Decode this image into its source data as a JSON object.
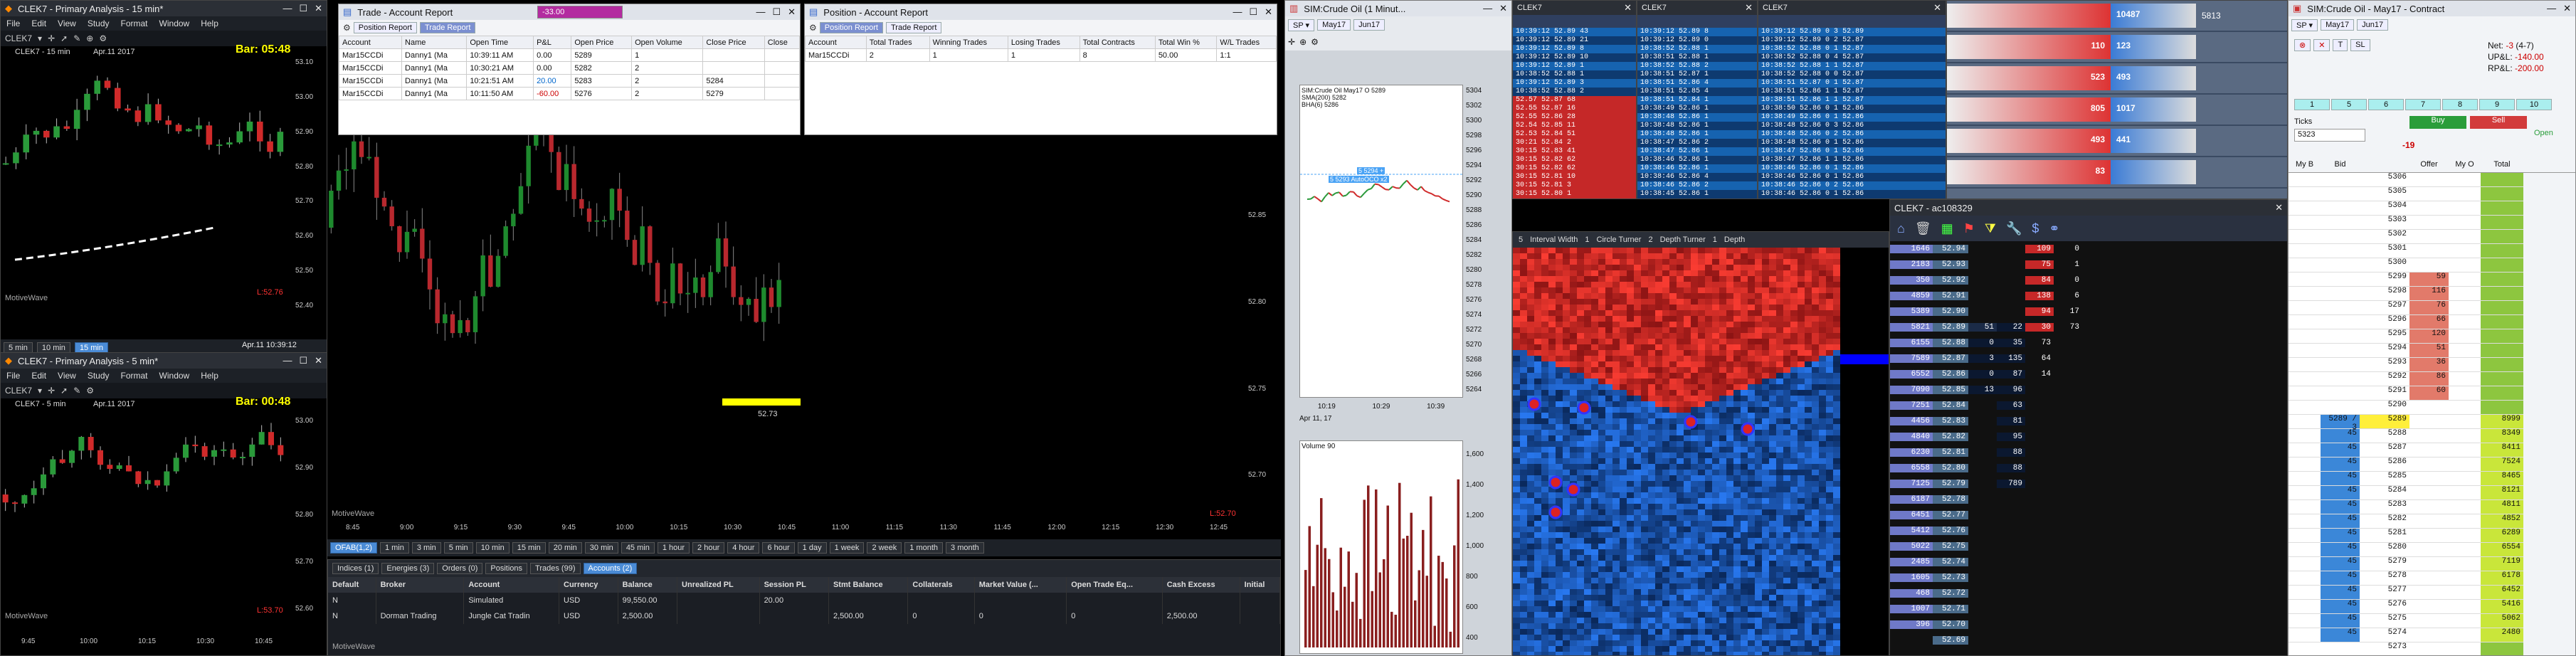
{
  "chart15": {
    "title": "CLEK7 - Primary Analysis - 15 min*",
    "menu": [
      "File",
      "Edit",
      "View",
      "Study",
      "Format",
      "Window",
      "Help"
    ],
    "symbol": "CLEK7",
    "subtitle": "CLEK7 - 15 min",
    "date": "Apr.11 2017",
    "bar_timer": "Bar: 05:48",
    "brand": "MotiveWave",
    "intervals": [
      "5 min",
      "10 min",
      "15 min"
    ],
    "stamp": "Apr.11 10:39:12",
    "prices": [
      "53.10",
      "53.00",
      "52.90",
      "52.80",
      "52.70",
      "52.60",
      "52.50",
      "52.40"
    ],
    "price_tags": [
      "52.97",
      "52.84",
      "52.84",
      "52.85"
    ],
    "times": [
      "9:30",
      "9:45",
      "10:00",
      "10:15",
      "10:30"
    ],
    "last": "L:52.76"
  },
  "chart5": {
    "title": "CLEK7 - Primary Analysis - 5 min*",
    "menu": [
      "File",
      "Edit",
      "View",
      "Study",
      "Format",
      "Window",
      "Help"
    ],
    "symbol": "CLEK7",
    "subtitle": "CLEK7 - 5 min",
    "date": "Apr.11 2017",
    "bar_timer": "Bar: 00:48",
    "brand": "MotiveWave",
    "prices": [
      "53.00",
      "52.90",
      "52.80",
      "52.70",
      "52.60"
    ],
    "price_tags": [
      "52.90",
      "52.84",
      "52.84"
    ],
    "times": [
      "9:45",
      "10:00",
      "10:15",
      "10:30",
      "10:45"
    ],
    "last": "L:53.70"
  },
  "trade_report": {
    "title": "Trade - Account Report",
    "tabs": [
      "Position Report",
      "Trade Report"
    ],
    "columns": [
      "Account",
      "Name",
      "Open Time",
      "P&L",
      "Open Price",
      "Open Volume",
      "Close Price",
      "Close"
    ],
    "rows": [
      [
        "Mar15CCDi",
        "Danny1 (Ma",
        "10:39:11 AM",
        "0.00",
        "5289",
        "1",
        "",
        ""
      ],
      [
        "Mar15CCDi",
        "Danny1 (Ma",
        "10:30:21 AM",
        "0.00",
        "5282",
        "2",
        "",
        ""
      ],
      [
        "Mar15CCDi",
        "Danny1 (Ma",
        "10:21:51 AM",
        "20.00",
        "5283",
        "2",
        "5284",
        ""
      ],
      [
        "Mar15CCDi",
        "Danny1 (Ma",
        "10:11:50 AM",
        "-60.00",
        "5276",
        "2",
        "5279",
        ""
      ]
    ],
    "pl_badge": "-33.00"
  },
  "position_report": {
    "title": "Position - Account Report",
    "tabs": [
      "Position Report",
      "Trade Report"
    ],
    "columns": [
      "Account",
      "Total Trades",
      "Winning Trades",
      "Losing Trades",
      "Total Contracts",
      "Total Win %",
      "W/L Trades"
    ],
    "rows": [
      [
        "Mar15CCDi",
        "2",
        "1",
        "1",
        "8",
        "50.00",
        "1:1"
      ]
    ]
  },
  "main_chart": {
    "brand": "MotiveWave",
    "prices": [
      "52.95",
      "52.90",
      "52.85",
      "52.80",
      "52.75",
      "52.70"
    ],
    "price_tags": [
      "52.90",
      "52.85",
      "52.84",
      "52.73"
    ],
    "times": [
      "8:45",
      "9:00",
      "9:15",
      "9:30",
      "9:45",
      "10:00",
      "10:15",
      "10:30",
      "10:45",
      "11:00",
      "11:15",
      "11:30",
      "11:45",
      "12:00",
      "12:15",
      "12:30",
      "12:45"
    ],
    "poc_label": "52.73",
    "last": "L:52.70",
    "intervals": [
      "OFAB(1,2)",
      "1 min",
      "3 min",
      "5 min",
      "10 min",
      "15 min",
      "20 min",
      "30 min",
      "45 min",
      "1 hour",
      "2 hour",
      "4 hour",
      "6 hour",
      "1 day",
      "1 week",
      "2 week",
      "1 month",
      "3 month"
    ]
  },
  "accounts": {
    "tabs": [
      "Indices (1)",
      "Energies (3)",
      "Orders (0)",
      "Positions",
      "Trades (99)",
      "Accounts (2)"
    ],
    "columns": [
      "Default",
      "Broker",
      "Account",
      "Currency",
      "Balance",
      "Unrealized PL",
      "Session PL",
      "Stmt Balance",
      "Collaterals",
      "Market Value (...",
      "Open Trade Eq...",
      "Cash Excess",
      "Initial"
    ],
    "rows": [
      [
        "N",
        "",
        "Simulated",
        "USD",
        "99,550.00",
        "",
        "20.00",
        "",
        "",
        "",
        "",
        "",
        ""
      ],
      [
        "N",
        "Dorman Trading",
        "Jungle Cat Tradin",
        "USD",
        "2,500.00",
        "",
        "",
        "2,500.00",
        "0",
        "0",
        "0",
        "2,500.00",
        ""
      ]
    ],
    "brand": "MotiveWave"
  },
  "mini_chart": {
    "title": "SIM:Crude Oil (1 Minut...",
    "dropdowns": [
      "May17",
      "Jun17"
    ],
    "legend": [
      "SIM:Crude Oil May17 O 5289",
      "SMA(200) 5282",
      "BHA(6) 5286"
    ],
    "prices": [
      "5304",
      "5302",
      "5300",
      "5298",
      "5296",
      "5294",
      "5292",
      "5290",
      "5288",
      "5286",
      "5284",
      "5282",
      "5280",
      "5278",
      "5276",
      "5274",
      "5272",
      "5270",
      "5268",
      "5266",
      "5264"
    ],
    "times": [
      "10:19",
      "10:29",
      "10:39"
    ],
    "date": "Apr 11, 17",
    "order_labels": [
      "5 5294 +",
      "5 5293 AutoOCO x2"
    ],
    "last": "5289",
    "volume_title": "Volume 90",
    "volume_axis": [
      "1,600",
      "1,400",
      "1,200",
      "1,000",
      "800",
      "600",
      "400"
    ]
  },
  "tape1": {
    "title": "CLEK7",
    "rows": [
      [
        "10:39:12",
        "52.89",
        "43"
      ],
      [
        "10:39:12",
        "52.89",
        "21"
      ],
      [
        "10:39:12",
        "52.89",
        "8"
      ],
      [
        "10:39:12",
        "52.89",
        "10"
      ],
      [
        "10:39:12",
        "52.89",
        "1"
      ],
      [
        "10:38:52",
        "52.88",
        "1"
      ],
      [
        "10:39:12",
        "52.89",
        "3"
      ],
      [
        "10:38:52",
        "52.88",
        "2"
      ],
      [
        "52.57",
        "52.87",
        "68"
      ],
      [
        "52.55",
        "52.87",
        "16"
      ],
      [
        "52.55",
        "52.86",
        "28"
      ],
      [
        "52.54",
        "52.85",
        "11"
      ],
      [
        "52.53",
        "52.84",
        "51"
      ],
      [
        "30:21",
        "52.84",
        "2"
      ],
      [
        "30:15",
        "52.83",
        "41"
      ],
      [
        "30:15",
        "52.82",
        "62"
      ],
      [
        "30:15",
        "52.82",
        "62"
      ],
      [
        "30:15",
        "52.81",
        "10"
      ],
      [
        "30:15",
        "52.81",
        "3"
      ],
      [
        "30:15",
        "52.80",
        "1"
      ]
    ]
  },
  "tape2": {
    "title": "CLEK7",
    "rows": [
      [
        "10:39:12",
        "52.89",
        "8"
      ],
      [
        "10:39:12",
        "52.89",
        "0"
      ],
      [
        "10:38:52",
        "52.88",
        "1"
      ],
      [
        "10:38:51",
        "52.88",
        "1"
      ],
      [
        "10:38:52",
        "52.88",
        "2"
      ],
      [
        "10:38:51",
        "52.87",
        "1"
      ],
      [
        "10:38:51",
        "52.86",
        "4"
      ],
      [
        "10:38:51",
        "52.85",
        "4"
      ],
      [
        "10:38:51",
        "52.84",
        "1"
      ],
      [
        "10:38:49",
        "52.86",
        "1"
      ],
      [
        "10:38:48",
        "52.86",
        "1"
      ],
      [
        "10:38:48",
        "52.86",
        "1"
      ],
      [
        "10:38:48",
        "52.86",
        "1"
      ],
      [
        "10:38:47",
        "52.86",
        "2"
      ],
      [
        "10:38:47",
        "52.86",
        "1"
      ],
      [
        "10:38:46",
        "52.86",
        "1"
      ],
      [
        "10:38:46",
        "52.86",
        "1"
      ],
      [
        "10:38:46",
        "52.86",
        "4"
      ],
      [
        "10:38:46",
        "52.86",
        "2"
      ],
      [
        "10:38:45",
        "52.86",
        "1"
      ]
    ]
  },
  "tape3": {
    "title": "CLEK7",
    "rows": [
      [
        "10:39:12",
        "52.89",
        "0",
        "3",
        "52.89"
      ],
      [
        "10:39:12",
        "52.89",
        "0",
        "2",
        "52.87"
      ],
      [
        "10:38:52",
        "52.88",
        "0",
        "1",
        "52.87"
      ],
      [
        "10:38:52",
        "52.88",
        "0",
        "4",
        "52.87"
      ],
      [
        "10:38:52",
        "52.88",
        "1",
        "1",
        "52.87"
      ],
      [
        "10:38:52",
        "52.88",
        "0",
        "0",
        "52.87"
      ],
      [
        "10:38:51",
        "52.87",
        "0",
        "1",
        "52.87"
      ],
      [
        "10:38:51",
        "52.86",
        "1",
        "1",
        "52.87"
      ],
      [
        "10:38:51",
        "52.86",
        "1",
        "1",
        "52.87"
      ],
      [
        "10:38:50",
        "52.86",
        "0",
        "1",
        "52.86"
      ],
      [
        "10:38:49",
        "52.86",
        "0",
        "1",
        "52.86"
      ],
      [
        "10:38:48",
        "52.86",
        "0",
        "3",
        "52.86"
      ],
      [
        "10:38:48",
        "52.86",
        "0",
        "2",
        "52.86"
      ],
      [
        "10:38:48",
        "52.86",
        "0",
        "1",
        "52.86"
      ],
      [
        "10:38:47",
        "52.86",
        "0",
        "1",
        "52.86"
      ],
      [
        "10:38:47",
        "52.86",
        "1",
        "1",
        "52.86"
      ],
      [
        "10:38:46",
        "52.86",
        "0",
        "1",
        "52.86"
      ],
      [
        "10:38:46",
        "52.86",
        "0",
        "1",
        "52.86"
      ],
      [
        "10:38:46",
        "52.86",
        "0",
        "2",
        "52.86"
      ],
      [
        "10:38:46",
        "52.86",
        "0",
        "1",
        "52.86"
      ]
    ]
  },
  "heatmap": {
    "toolbar": [
      "Interval Width",
      "Circle Turner",
      "Depth Turner",
      "Depth"
    ],
    "toolbar_values": [
      "5",
      "1",
      "2",
      "1"
    ]
  },
  "dom_ladder": {
    "title": "CLEK7 - ac108329",
    "rows": [
      [
        "1646",
        "52.94",
        "",
        "",
        "109",
        "0"
      ],
      [
        "2183",
        "52.93",
        "",
        "",
        "75",
        "1"
      ],
      [
        "350",
        "52.92",
        "",
        "",
        "84",
        "0"
      ],
      [
        "4859",
        "52.91",
        "",
        "",
        "138",
        "6"
      ],
      [
        "5389",
        "52.90",
        "",
        "",
        "94",
        "17"
      ],
      [
        "5821",
        "52.89",
        "51",
        "22",
        "30",
        "73"
      ],
      [
        "6155",
        "52.88",
        "0",
        "35",
        "73",
        ""
      ],
      [
        "7589",
        "52.87",
        "3",
        "135",
        "64",
        ""
      ],
      [
        "6552",
        "52.86",
        "0",
        "87",
        "14",
        ""
      ],
      [
        "7090",
        "52.85",
        "13",
        "96",
        "",
        ""
      ],
      [
        "7251",
        "52.84",
        "",
        "63",
        "",
        ""
      ],
      [
        "4456",
        "52.83",
        "",
        "81",
        "",
        ""
      ],
      [
        "4840",
        "52.82",
        "",
        "95",
        "",
        ""
      ],
      [
        "6230",
        "52.81",
        "",
        "88",
        "",
        ""
      ],
      [
        "6558",
        "52.80",
        "",
        "88",
        "",
        ""
      ],
      [
        "7125",
        "52.79",
        "",
        "789",
        "",
        ""
      ],
      [
        "6187",
        "52.78",
        "",
        "",
        "",
        ""
      ],
      [
        "6451",
        "52.77",
        "",
        "",
        "",
        ""
      ],
      [
        "5412",
        "52.76",
        "",
        "",
        "",
        ""
      ],
      [
        "5022",
        "52.75",
        "",
        "",
        "",
        ""
      ],
      [
        "2485",
        "52.74",
        "",
        "",
        "",
        ""
      ],
      [
        "1605",
        "52.73",
        "",
        "",
        "",
        ""
      ],
      [
        "468",
        "52.72",
        "",
        "",
        "",
        ""
      ],
      [
        "1007",
        "52.71",
        "",
        "",
        "",
        ""
      ],
      [
        "396",
        "52.70",
        "",
        "",
        "",
        ""
      ],
      [
        "",
        "52.69",
        "",
        "",
        "",
        ""
      ]
    ]
  },
  "quotes": {
    "rows": [
      {
        "bid": "",
        "ask": "10487",
        "size": "5813"
      },
      {
        "bid": "110",
        "ask": "123",
        "size": ""
      },
      {
        "bid": "523",
        "ask": "493",
        "size": ""
      },
      {
        "bid": "805",
        "ask": "1017",
        "size": ""
      },
      {
        "bid": "493",
        "ask": "441",
        "size": ""
      },
      {
        "bid": "83",
        "ask": "",
        "size": ""
      }
    ]
  },
  "order_ticket": {
    "title": "SIM:Crude Oil - May17 - Contract",
    "dropdowns": [
      "May17",
      "Jun17"
    ],
    "net_label": "Net:",
    "net_value": "-3",
    "net_extra": "(4-7)",
    "upl_label": "UP&L:",
    "upl_value": "-140.00",
    "rpl_label": "RP&L:",
    "rpl_value": "-200.00",
    "qty": "5323",
    "ticks_label": "Ticks",
    "buy": "Buy",
    "sell": "Sell",
    "open_label": "Open",
    "pl_ticks": "-19",
    "cols": [
      "My B",
      "Bid",
      "",
      "Offer",
      "My O",
      "Total"
    ],
    "qty_buttons": [
      "1",
      "5",
      "6",
      "7",
      "8",
      "9",
      "10"
    ],
    "ladder": [
      [
        "",
        "",
        "5306",
        "",
        "",
        "",
        ""
      ],
      [
        "",
        "",
        "5305",
        "",
        "",
        "",
        ""
      ],
      [
        "",
        "",
        "5304",
        "",
        "",
        "",
        ""
      ],
      [
        "",
        "",
        "5303",
        "",
        "",
        "",
        ""
      ],
      [
        "",
        "",
        "5302",
        "",
        "",
        "",
        ""
      ],
      [
        "",
        "",
        "5301",
        "",
        "",
        "",
        ""
      ],
      [
        "",
        "",
        "5300",
        "",
        "",
        "",
        ""
      ],
      [
        "",
        "",
        "5299",
        "",
        "",
        "",
        ""
      ],
      [
        "",
        "",
        "5298",
        "",
        "",
        "",
        ""
      ],
      [
        "",
        "",
        "5297",
        "",
        "",
        "",
        ""
      ],
      [
        "",
        "",
        "5296",
        "",
        "",
        "",
        ""
      ],
      [
        "",
        "",
        "5295",
        "",
        "",
        "",
        ""
      ],
      [
        "",
        "",
        "5294",
        "",
        "",
        "",
        ""
      ],
      [
        "",
        "",
        "5293",
        "",
        "",
        "",
        ""
      ],
      [
        "",
        "",
        "5292",
        "",
        "",
        "",
        ""
      ],
      [
        "",
        "",
        "5291",
        "",
        "",
        "",
        ""
      ],
      [
        "",
        "",
        "5290",
        "",
        "",
        "",
        ""
      ],
      [
        "",
        "",
        "5289",
        "",
        "",
        "",
        ""
      ],
      [
        "",
        "",
        "5288",
        "",
        "",
        "",
        ""
      ],
      [
        "",
        "",
        "5287",
        "",
        "",
        "",
        ""
      ],
      [
        "",
        "",
        "5286",
        "",
        "",
        "",
        ""
      ],
      [
        "",
        "",
        "5285",
        "",
        "",
        "",
        ""
      ],
      [
        "",
        "",
        "5284",
        "",
        "",
        "",
        ""
      ],
      [
        "",
        "",
        "5283",
        "",
        "",
        "",
        ""
      ],
      [
        "",
        "",
        "5282",
        "",
        "",
        "",
        ""
      ],
      [
        "",
        "",
        "5281",
        "",
        "",
        "",
        ""
      ],
      [
        "",
        "",
        "5280",
        "",
        "",
        "",
        ""
      ],
      [
        "",
        "",
        "5279",
        "",
        "",
        "",
        ""
      ],
      [
        "",
        "",
        "5278",
        "",
        "",
        "",
        ""
      ],
      [
        "",
        "",
        "5277",
        "",
        "",
        "",
        ""
      ],
      [
        "",
        "",
        "5276",
        "",
        "",
        "",
        ""
      ],
      [
        "",
        "",
        "5275",
        "",
        "",
        "",
        ""
      ],
      [
        "",
        "",
        "5274",
        "",
        "",
        "",
        ""
      ],
      [
        "",
        "",
        "5273",
        "",
        "",
        "",
        ""
      ]
    ],
    "offer_vals": [
      "",
      "",
      "",
      "",
      "",
      "",
      "",
      "59",
      "116",
      "76",
      "66",
      "120",
      "51",
      "36",
      "86",
      "60",
      "",
      "",
      "",
      "",
      "",
      "",
      "",
      "",
      "",
      "",
      "",
      "",
      "",
      "",
      "",
      "",
      "",
      ""
    ],
    "bid_vals": [
      "",
      "",
      "",
      "",
      "",
      "",
      "",
      "",
      "",
      "",
      "",
      "",
      "",
      "",
      "",
      "",
      "",
      "5289 / 3",
      "45",
      "45",
      "45",
      "45",
      "45",
      "45",
      "45",
      "45",
      "45",
      "45",
      "45",
      "45",
      "45",
      "45",
      "45",
      ""
    ],
    "total_vals": [
      "",
      "",
      "",
      "",
      "",
      "",
      "",
      "",
      "",
      "",
      "",
      "",
      "",
      "",
      "",
      "",
      "",
      "8999",
      "8349",
      "8411",
      "7524",
      "8465",
      "8121",
      "4811",
      "4852",
      "6289",
      "6554",
      "7119",
      "6178",
      "6452",
      "5416",
      "5062",
      "2480",
      ""
    ],
    "last_price_row": 17
  }
}
